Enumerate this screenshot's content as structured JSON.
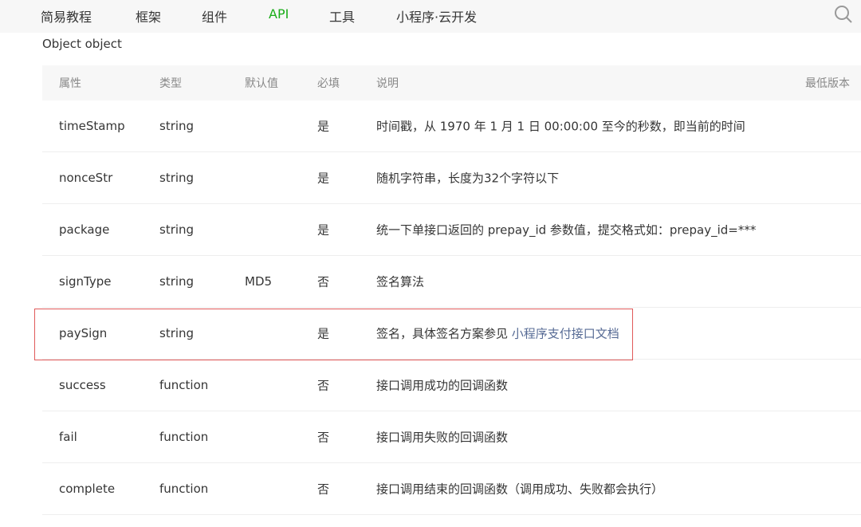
{
  "nav": {
    "items": [
      "简易教程",
      "框架",
      "组件",
      "API",
      "工具",
      "小程序·云开发"
    ],
    "active": 3
  },
  "section_title": "Object object",
  "table": {
    "headers": [
      "属性",
      "类型",
      "默认值",
      "必填",
      "说明",
      "最低版本"
    ],
    "rows": [
      {
        "name": "timeStamp",
        "type": "string",
        "default": "",
        "required": "是",
        "desc": "时间戳，从 1970 年 1 月 1 日 00:00:00 至今的秒数，即当前的时间"
      },
      {
        "name": "nonceStr",
        "type": "string",
        "default": "",
        "required": "是",
        "desc": "随机字符串，长度为32个字符以下"
      },
      {
        "name": "package",
        "type": "string",
        "default": "",
        "required": "是",
        "desc": "统一下单接口返回的 prepay_id 参数值，提交格式如：prepay_id=***"
      },
      {
        "name": "signType",
        "type": "string",
        "default": "MD5",
        "required": "否",
        "desc": "签名算法"
      },
      {
        "name": "paySign",
        "type": "string",
        "default": "",
        "required": "是",
        "desc": "签名，具体签名方案参见 ",
        "link": "小程序支付接口文档"
      },
      {
        "name": "success",
        "type": "function",
        "default": "",
        "required": "否",
        "desc": "接口调用成功的回调函数"
      },
      {
        "name": "fail",
        "type": "function",
        "default": "",
        "required": "否",
        "desc": "接口调用失败的回调函数"
      },
      {
        "name": "complete",
        "type": "function",
        "default": "",
        "required": "否",
        "desc": "接口调用结束的回调函数（调用成功、失败都会执行）"
      }
    ]
  },
  "colors": {
    "accent": "#1aad19",
    "link": "#576b95",
    "highlight": "#e05a5a"
  }
}
